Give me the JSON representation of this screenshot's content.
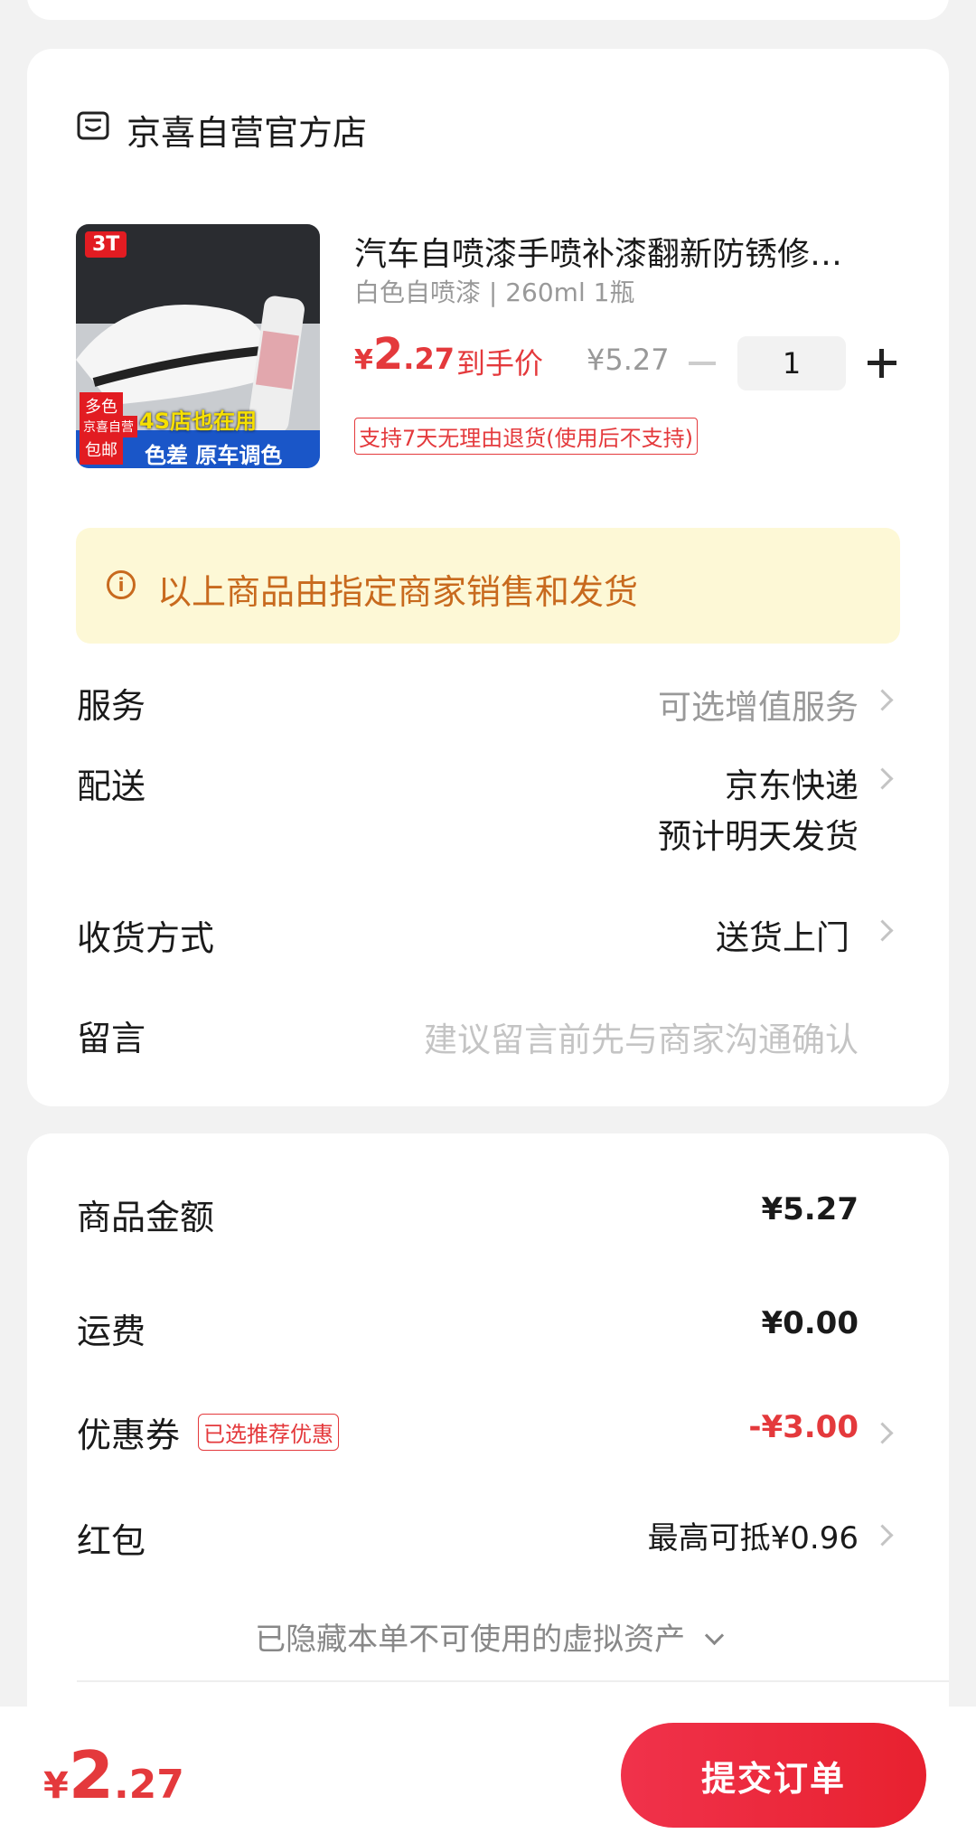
{
  "store": {
    "name": "京喜自营官方店"
  },
  "product": {
    "title": "汽车自喷漆手喷补漆翻新防锈修…",
    "spec": "白色自喷漆 | 260ml 1瓶",
    "price_symbol": "¥",
    "price_int": "2",
    "price_dec": ".27",
    "price_tag": "到手价",
    "original_price": "¥5.27",
    "quantity": "1",
    "return_policy": "支持7天无理由退货(使用后不支持)",
    "image_texts": {
      "brand": "3T",
      "badge_multi": "多色",
      "badge_self": "京喜自营",
      "badge_free": "包邮",
      "line1": "4S店也在用",
      "line2": "色差 原车调色"
    }
  },
  "notice": "以上商品由指定商家销售和发货",
  "rows": {
    "service_label": "服务",
    "service_value": "可选增值服务",
    "delivery_label": "配送",
    "delivery_value": "京东快递",
    "delivery_sub": "预计明天发货",
    "receive_label": "收货方式",
    "receive_value": "送货上门",
    "message_label": "留言",
    "message_placeholder": "建议留言前先与商家沟通确认"
  },
  "summary": {
    "goods_label": "商品金额",
    "goods_value": "¥5.27",
    "shipping_label": "运费",
    "shipping_value": "¥0.00",
    "coupon_label": "优惠券",
    "coupon_tag": "已选推荐优惠",
    "coupon_value": "-¥3.00",
    "redpacket_label": "红包",
    "redpacket_value": "最高可抵¥0.96",
    "hidden_assets": "已隐藏本单不可使用的虚拟资产"
  },
  "footer": {
    "price_symbol": "¥",
    "price_int": "2",
    "price_dec": ".27",
    "submit_label": "提交订单"
  },
  "colors": {
    "accent": "#e4393c",
    "notice_bg": "#fdf8d6",
    "notice_text": "#c86a1e"
  }
}
